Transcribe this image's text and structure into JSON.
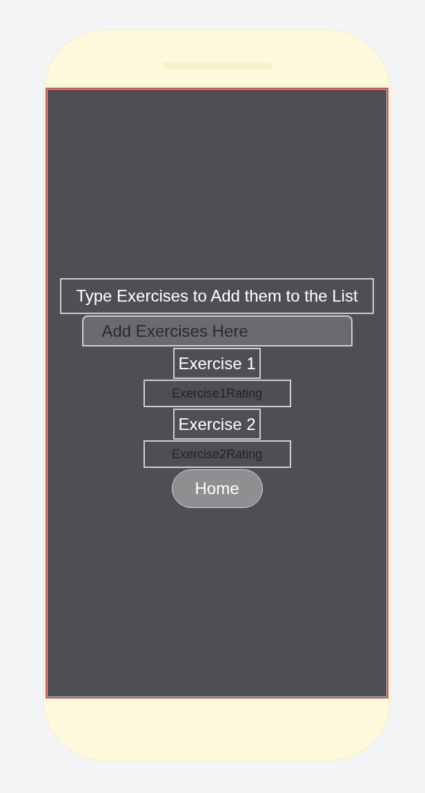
{
  "instruction": "Type Exercises to Add them to the List",
  "exercise_input": {
    "placeholder": "Add Exercises Here"
  },
  "exercises": [
    {
      "name": "Exercise 1",
      "rating": "Exercise1Rating"
    },
    {
      "name": "Exercise 2",
      "rating": "Exercise2Rating"
    }
  ],
  "home_button": "Home"
}
